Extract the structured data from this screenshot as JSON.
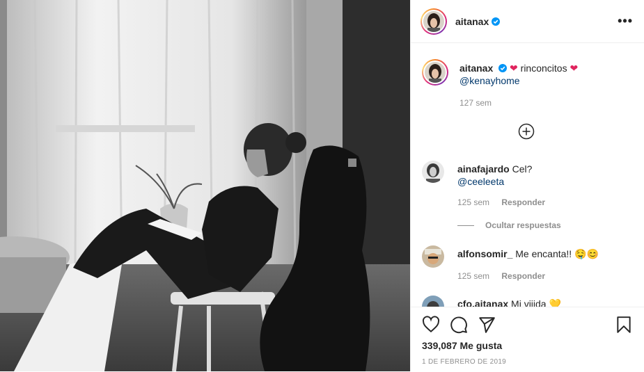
{
  "post": {
    "username": "aitanax",
    "caption_text": "rinconcitos",
    "caption_mention": "@kenayhome",
    "caption_time": "127 sem",
    "likes": "339,087 Me gusta",
    "date": "1 DE FEBRERO DE 2019"
  },
  "comments": [
    {
      "user": "ainafajardo",
      "text": "Cel?",
      "mention": "@ceeleeta",
      "time": "125 sem",
      "reply": "Responder"
    },
    {
      "user": "alfonsomir_",
      "text": "Me encanta!!",
      "time": "125 sem",
      "reply": "Responder"
    },
    {
      "user": "cfo.aitanax",
      "text": "Mi viiida"
    }
  ],
  "hide_replies": "Ocultar respuestas",
  "icons": [
    "heart-icon",
    "comment-icon",
    "share-icon",
    "bookmark-icon",
    "more-icon",
    "verified-icon",
    "add-icon"
  ],
  "colors": {
    "verified": "#0095f6",
    "heart_red": "#e0245e",
    "mention": "#00376b",
    "muted": "#8e8e8e"
  }
}
